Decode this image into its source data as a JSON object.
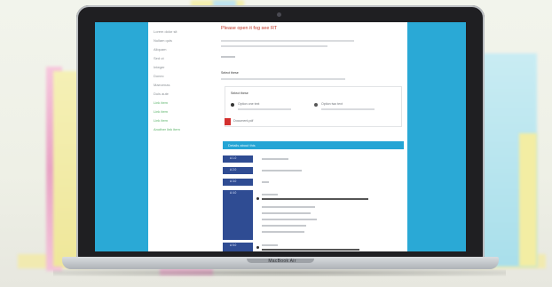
{
  "laptop": {
    "brand": "MacBook Air"
  },
  "page": {
    "title": "Please open it fog see RT",
    "colors": {
      "accent": "#24a5d5",
      "title": "#c0392b",
      "sidebar_link": "#5cb36a",
      "table_header": "#2f4c93"
    }
  },
  "sidebar": {
    "items": [
      {
        "label": "Lorem dolor sit"
      },
      {
        "label": "Nullam quis"
      },
      {
        "label": "Aliquam"
      },
      {
        "label": "Sed ut"
      },
      {
        "label": "Integer"
      },
      {
        "label": "Donec"
      },
      {
        "label": "Maecenas"
      },
      {
        "label": "Duis aute"
      },
      {
        "label": "Link item",
        "green": true
      },
      {
        "label": "Link item",
        "green": true
      },
      {
        "label": "Link item",
        "green": true
      },
      {
        "label": "Another link item",
        "green": true
      }
    ]
  },
  "content": {
    "section_title": "Select these",
    "card_heading": "Select these",
    "option_a": "Option one text",
    "option_b": "Option two text",
    "attachment": "Document.pdf",
    "bluebar": "Details about this",
    "rows": [
      {
        "cell": "A 1.0"
      },
      {
        "cell": "A 2.0"
      },
      {
        "cell": "A 3.0"
      },
      {
        "cell": "A 4.0"
      },
      {
        "cell": "A 5.0"
      }
    ]
  }
}
